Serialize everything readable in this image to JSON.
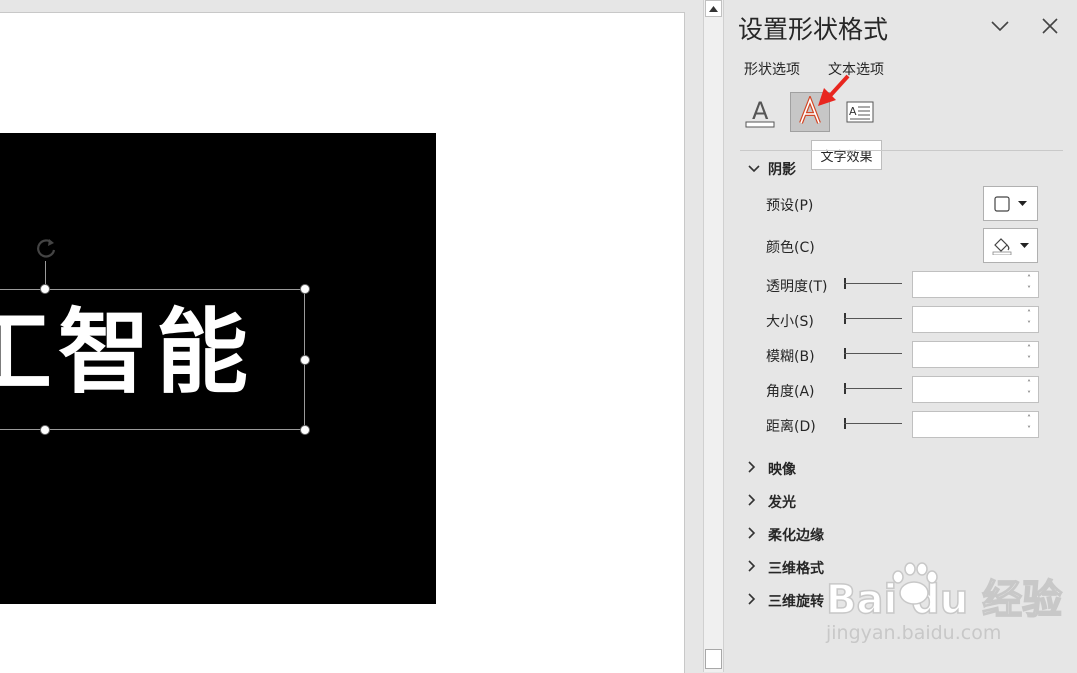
{
  "slide": {
    "main_text": "工智能"
  },
  "pane": {
    "title": "设置形状格式",
    "tabs": [
      {
        "label": "形状选项"
      },
      {
        "label": "文本选项"
      }
    ],
    "tooltip": "文字效果",
    "shadow": {
      "header": "阴影",
      "preset_label": "预设(P)",
      "color_label": "颜色(C)",
      "transparency_label": "透明度(T)",
      "size_label": "大小(S)",
      "blur_label": "模糊(B)",
      "angle_label": "角度(A)",
      "distance_label": "距离(D)"
    },
    "sections": [
      {
        "label": "映像"
      },
      {
        "label": "发光"
      },
      {
        "label": "柔化边缘"
      },
      {
        "label": "三维格式"
      },
      {
        "label": "三维旋转"
      }
    ]
  },
  "watermark": {
    "brand": "Bai du 经验",
    "url": "jingyan.baidu.com"
  },
  "colors": {
    "accent_red": "#e8261f",
    "text_effects_orange": "#d24726",
    "pane_bg": "#e6e6e6"
  }
}
